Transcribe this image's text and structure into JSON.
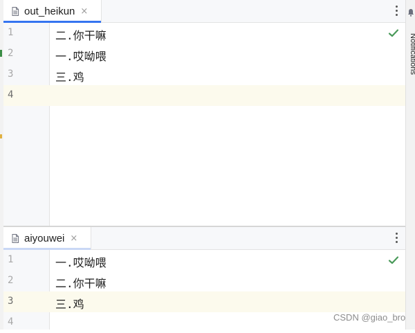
{
  "colors": {
    "accent": "#3574f0",
    "check": "#4a9a5a",
    "current_line": "#fcfaed",
    "gutter": "#f7f8fa"
  },
  "right_panel": {
    "label": "Notifications",
    "icon": "bell-icon"
  },
  "top_editor": {
    "tab": {
      "label": "out_heikun",
      "close": "×",
      "icon": "file-icon"
    },
    "menu_icon": "more-vertical-icon",
    "status_icon": "check-icon",
    "lines": [
      {
        "number": "1",
        "text": "二.你干嘛"
      },
      {
        "number": "2",
        "text": "一.哎呦喂"
      },
      {
        "number": "3",
        "text": "三.鸡"
      },
      {
        "number": "4",
        "text": ""
      }
    ],
    "current_line": 4
  },
  "bottom_editor": {
    "tab": {
      "label": "aiyouwei",
      "close": "×",
      "icon": "file-icon"
    },
    "menu_icon": "more-vertical-icon",
    "status_icon": "check-icon",
    "lines": [
      {
        "number": "1",
        "text": "一.哎呦喂"
      },
      {
        "number": "2",
        "text": "二.你干嘛"
      },
      {
        "number": "3",
        "text": "三.鸡"
      },
      {
        "number": "4",
        "text": ""
      }
    ],
    "current_line": 3
  },
  "watermark": "CSDN @giao_bro"
}
